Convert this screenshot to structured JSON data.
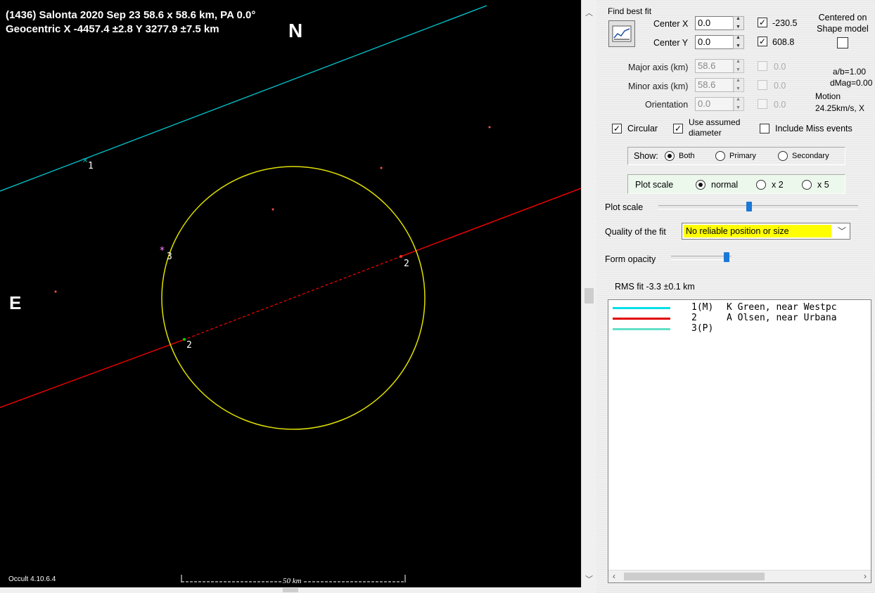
{
  "plot": {
    "title_line1": "(1436) Salonta  2020 Sep 23  58.6 x 58.6 km, PA 0.0°",
    "title_line2": "Geocentric  X  -4457.4 ±2.8  Y 3277.9 ±7.5 km",
    "north": "N",
    "east": "E",
    "version": "Occult 4.10.6.4",
    "scale_bar": "50 km",
    "chord_labels": [
      "1",
      "3",
      "2",
      "2"
    ],
    "colors": {
      "background": "#000000",
      "ellipse": "#ffff00",
      "chord1": "#00c8d0",
      "chord2": "#ff0000",
      "chord3": "#ff80ff"
    }
  },
  "panel": {
    "find_best_fit": "Find best fit",
    "center_x_label": "Center X",
    "center_x_value": "0.0",
    "center_x_fixed": "-230.5",
    "center_y_label": "Center Y",
    "center_y_value": "0.0",
    "center_y_fixed": "608.8",
    "centered_on_shape": "Centered on Shape model",
    "major_axis_label": "Major axis (km)",
    "major_axis_value": "58.6",
    "major_axis_fixed": "0.0",
    "minor_axis_label": "Minor axis (km)",
    "minor_axis_value": "58.6",
    "minor_axis_fixed": "0.0",
    "orientation_label": "Orientation",
    "orientation_value": "0.0",
    "orientation_fixed": "0.0",
    "ab_ratio": "a/b=1.00",
    "dmag": "dMag=0.00",
    "motion_label": "Motion",
    "motion_value": "24.25km/s, X",
    "circular": "Circular",
    "use_assumed_diameter": "Use assumed diameter",
    "include_miss": "Include Miss events",
    "show_label": "Show:",
    "show_options": [
      "Both",
      "Primary",
      "Secondary"
    ],
    "plot_scale_label": "Plot scale",
    "plot_scale_options": [
      "normal",
      "x 2",
      "x 5"
    ],
    "plot_scale_slider_label": "Plot scale",
    "quality_label": "Quality of the fit",
    "quality_value": "No reliable position or size",
    "form_opacity_label": "Form opacity",
    "rms_fit": "RMS fit -3.3 ±0.1 km",
    "observers": [
      {
        "num": "1(M)",
        "name": "K Green, near Westpc",
        "color": "#00e0e8"
      },
      {
        "num": "2",
        "name": "A Olsen, near Urbana",
        "color": "#e00000"
      },
      {
        "num": "3(P)",
        "name": "",
        "color": "#60e0c8"
      }
    ]
  }
}
